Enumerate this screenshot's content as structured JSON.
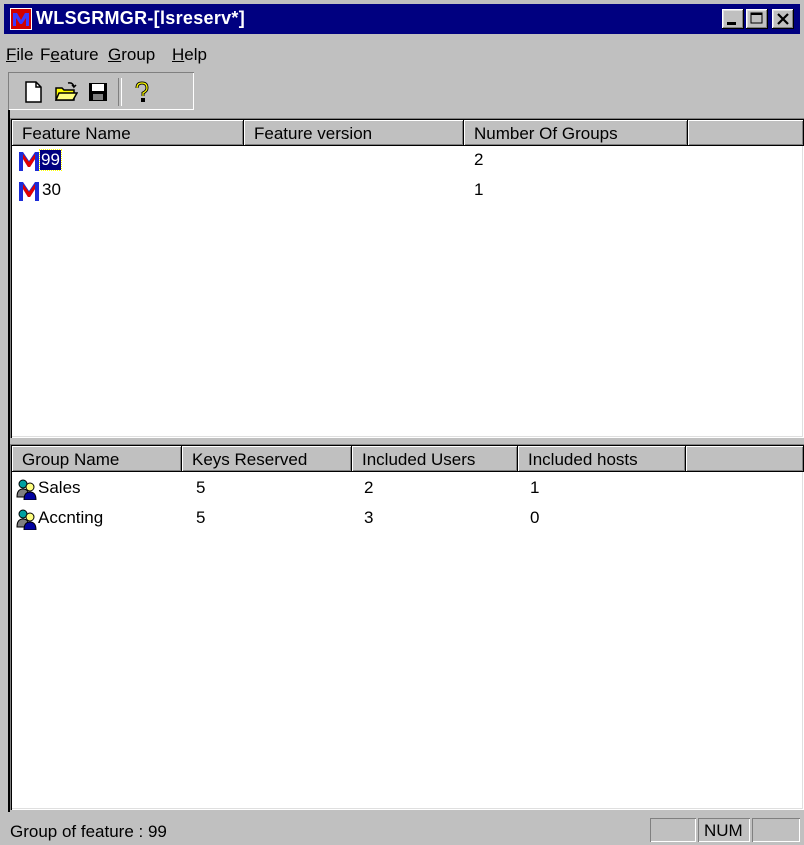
{
  "window": {
    "title": "WLSGRMGR-[lsreserv*]",
    "accent": "#000080"
  },
  "menu": {
    "items": [
      {
        "label": "File",
        "underline": "F",
        "rest": "ile"
      },
      {
        "label": "Feature",
        "underline": "e",
        "pre": "F",
        "rest": "ature"
      },
      {
        "label": "Group",
        "underline": "G",
        "rest": "roup"
      },
      {
        "label": "Help",
        "underline": "H",
        "rest": "elp"
      }
    ]
  },
  "toolbar": {
    "icons": [
      "new-document-icon",
      "open-folder-icon",
      "save-disk-icon",
      "help-question-icon"
    ]
  },
  "features": {
    "columns": [
      "Feature Name",
      "Feature version",
      "Number Of Groups",
      ""
    ],
    "rows": [
      {
        "name": "99",
        "version": "",
        "groups": "2",
        "selected": true,
        "icon": "feature-m-icon"
      },
      {
        "name": "30",
        "version": "",
        "groups": "1",
        "selected": false,
        "icon": "feature-m-icon"
      }
    ]
  },
  "groups": {
    "columns": [
      "Group Name",
      "Keys Reserved",
      "Included Users",
      "Included hosts",
      ""
    ],
    "rows": [
      {
        "name": "Sales",
        "keys": "5",
        "users": "2",
        "hosts": "1",
        "icon": "group-users-icon"
      },
      {
        "name": "Accnting",
        "keys": "5",
        "users": "3",
        "hosts": "0",
        "icon": "group-users-icon"
      }
    ]
  },
  "status": {
    "text": "Group of feature : 99",
    "num": "NUM"
  }
}
